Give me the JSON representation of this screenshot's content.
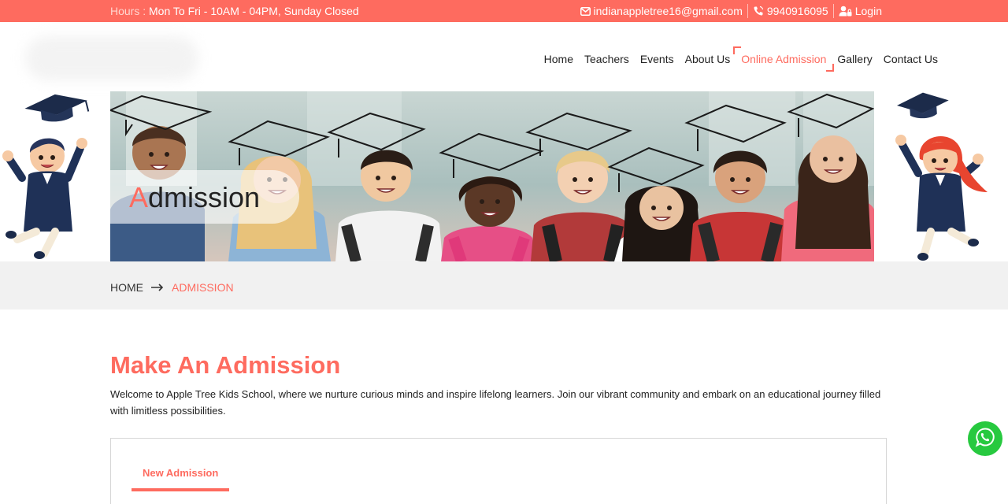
{
  "topbar": {
    "hours_label": "Hours : ",
    "hours_text": "Mon To Fri - 10AM - 04PM, Sunday Closed",
    "email": "indianappletree16@gmail.com",
    "phone": "9940916095",
    "login_label": "Login",
    "icons": [
      "envelope-icon",
      "phone-icon",
      "user-lock-icon"
    ]
  },
  "nav": {
    "items": [
      {
        "label": "Home"
      },
      {
        "label": "Teachers"
      },
      {
        "label": "Events"
      },
      {
        "label": "About Us"
      },
      {
        "label": "Online Admission",
        "active": true
      },
      {
        "label": "Gallery"
      },
      {
        "label": "Contact Us"
      }
    ]
  },
  "banner": {
    "title_first_letter": "A",
    "title_rest": "dmission"
  },
  "breadcrumb": {
    "home": "HOME",
    "current": "ADMISSION"
  },
  "main": {
    "heading": "Make An Admission",
    "intro": "Welcome to Apple Tree Kids School, where we nurture curious minds and inspire lifelong learners. Join our vibrant community and embark on an educational journey filled with limitless possibilities.",
    "tab_label": "New Admission"
  },
  "colors": {
    "accent": "#fe6b5f",
    "whatsapp": "#27c93f",
    "breadcrumb_bg": "#f1f1f1"
  },
  "floating": {
    "icon": "whatsapp-icon"
  }
}
